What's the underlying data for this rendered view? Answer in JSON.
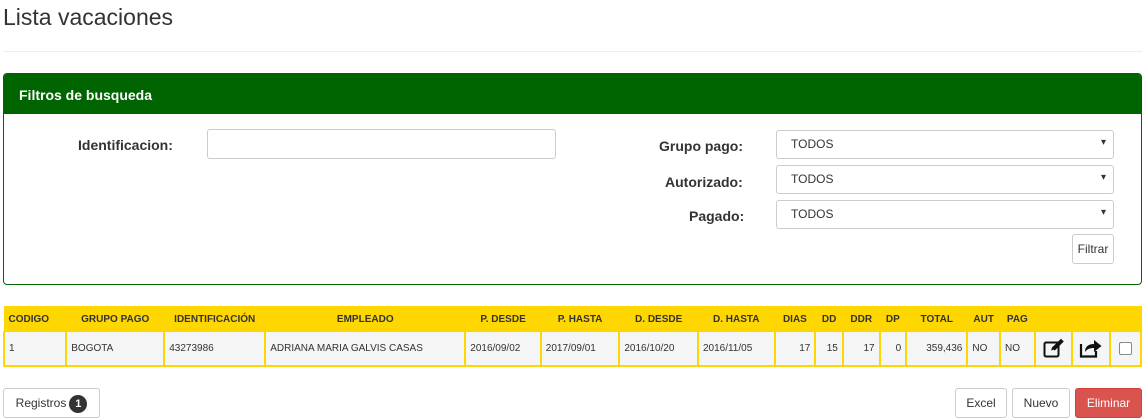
{
  "page": {
    "title": "Lista vacaciones"
  },
  "filters": {
    "heading": "Filtros de busqueda",
    "identificacion_label": "Identificacion:",
    "identificacion_value": "",
    "grupo_pago_label": "Grupo pago:",
    "grupo_pago_value": "TODOS",
    "autorizado_label": "Autorizado:",
    "autorizado_value": "TODOS",
    "pagado_label": "Pagado:",
    "pagado_value": "TODOS",
    "filtrar_label": "Filtrar",
    "caret": "▾"
  },
  "table": {
    "headers": [
      "CODIGO",
      "GRUPO PAGO",
      "IDENTIFICACIÓN",
      "EMPLEADO",
      "P. DESDE",
      "P. HASTA",
      "D. DESDE",
      "D. HASTA",
      "DIAS",
      "DD",
      "DDR",
      "DP",
      "TOTAL",
      "AUT",
      "PAG"
    ],
    "rows": [
      {
        "codigo": "1",
        "grupo_pago": "BOGOTA",
        "identificacion": "43273986",
        "empleado": "ADRIANA MARIA GALVIS CASAS",
        "p_desde": "2016/09/02",
        "p_hasta": "2017/09/01",
        "d_desde": "2016/10/20",
        "d_hasta": "2016/11/05",
        "dias": "17",
        "dd": "15",
        "ddr": "17",
        "dp": "0",
        "total": "359,436",
        "aut": "NO",
        "pag": "NO",
        "edit_icon": "edit-icon",
        "share_icon": "share-icon"
      }
    ]
  },
  "footer": {
    "registros_label": "Registros",
    "registros_count": "1",
    "excel_label": "Excel",
    "nuevo_label": "Nuevo",
    "eliminar_label": "Eliminar"
  },
  "colors": {
    "panel_green": "#006400",
    "table_yellow": "#ffd700",
    "danger_red": "#d9534f"
  }
}
